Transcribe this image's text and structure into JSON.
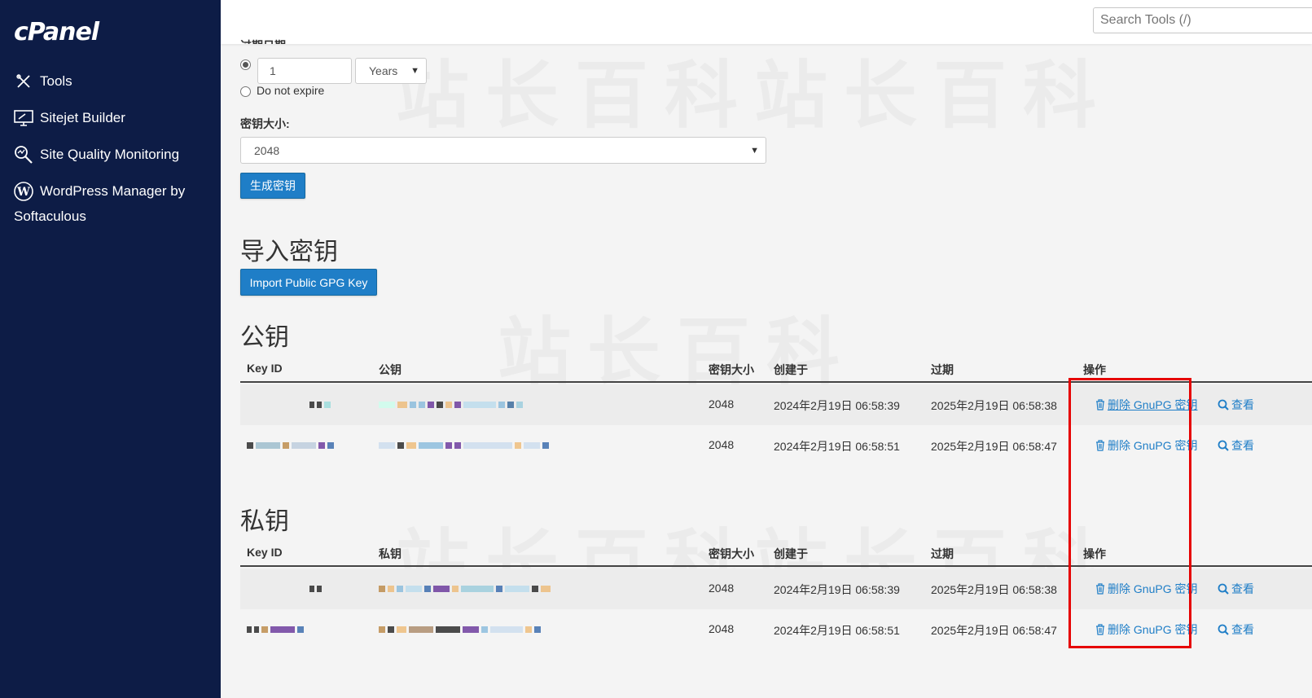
{
  "app": {
    "logo_text": "cPanel"
  },
  "sidebar": {
    "items": [
      {
        "label": "Tools",
        "icon": "tools-icon"
      },
      {
        "label": "Sitejet Builder",
        "icon": "monitor-icon"
      },
      {
        "label": "Site Quality Monitoring",
        "icon": "magnify-icon"
      },
      {
        "label": "WordPress Manager by Softaculous",
        "icon": "wordpress-icon"
      }
    ]
  },
  "topbar": {
    "search_placeholder": "Search Tools (/)"
  },
  "form": {
    "cut_label": "过期日期:",
    "expire_value": "1",
    "expire_unit": "Years",
    "no_expire_label": "Do not expire",
    "key_size_label": "密钥大小:",
    "key_size_value": "2048",
    "generate_button": "生成密钥"
  },
  "import_section": {
    "title": "导入密钥",
    "import_button": "Import Public GPG Key"
  },
  "public_keys": {
    "title": "公钥",
    "headers": {
      "key_id": "Key ID",
      "key": "公钥",
      "size": "密钥大小",
      "created": "创建于",
      "expires": "过期",
      "actions": "操作"
    },
    "rows": [
      {
        "size": "2048",
        "created": "2024年2月19日 06:58:39",
        "expires": "2025年2月19日 06:58:38",
        "delete": "删除 GnuPG 密钥",
        "view": "查看"
      },
      {
        "size": "2048",
        "created": "2024年2月19日 06:58:51",
        "expires": "2025年2月19日 06:58:47",
        "delete": "删除 GnuPG 密钥",
        "view": "查看"
      }
    ]
  },
  "private_keys": {
    "title": "私钥",
    "headers": {
      "key_id": "Key ID",
      "key": "私钥",
      "size": "密钥大小",
      "created": "创建于",
      "expires": "过期",
      "actions": "操作"
    },
    "rows": [
      {
        "size": "2048",
        "created": "2024年2月19日 06:58:39",
        "expires": "2025年2月19日 06:58:38",
        "delete": "删除 GnuPG 密钥",
        "view": "查看"
      },
      {
        "size": "2048",
        "created": "2024年2月19日 06:58:51",
        "expires": "2025年2月19日 06:58:47",
        "delete": "删除 GnuPG 密钥",
        "view": "查看"
      }
    ]
  },
  "watermark_text": "站长百科",
  "colors": {
    "sidebar_bg": "#0d1c46",
    "accent": "#1f7ec7",
    "highlight_box": "#e60000"
  }
}
